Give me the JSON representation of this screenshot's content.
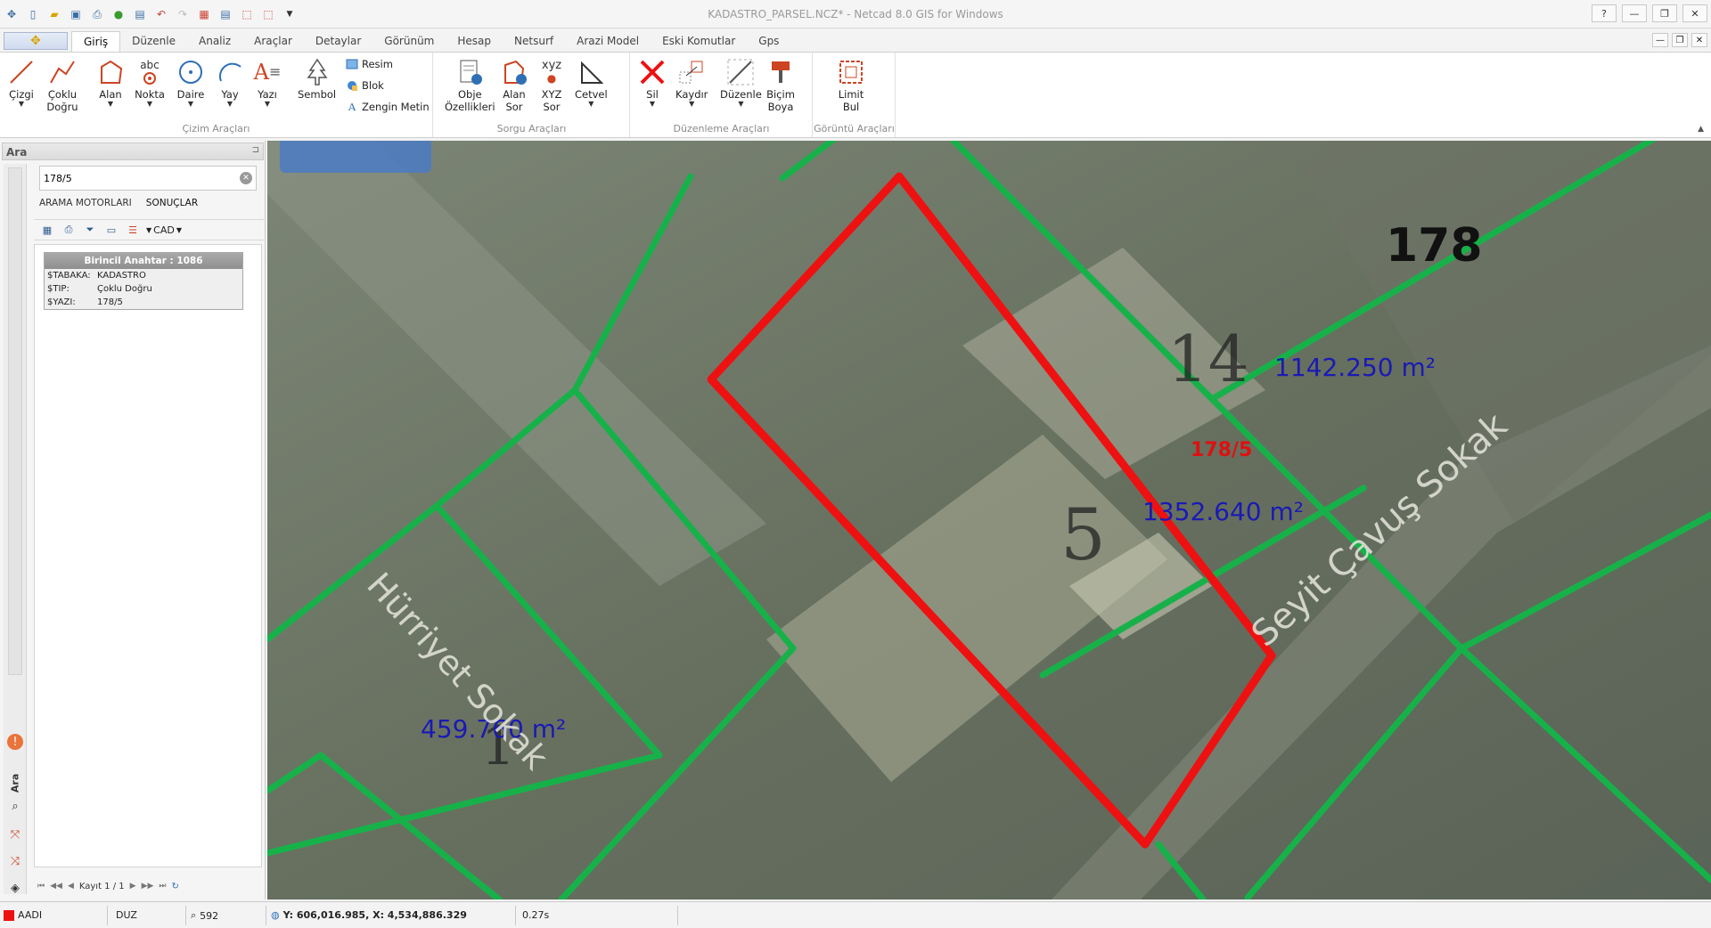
{
  "window": {
    "title": "KADASTRO_PARSEL.NCZ* - Netcad 8.0 GIS for Windows",
    "help": "?",
    "minimize": "—",
    "restore": "❐",
    "close": "✕"
  },
  "ribbon_tabs": [
    "Giriş",
    "Düzenle",
    "Analiz",
    "Araçlar",
    "Detaylar",
    "Görünüm",
    "Hesap",
    "Netsurf",
    "Arazi Model",
    "Eski Komutlar",
    "Gps"
  ],
  "ribbon": {
    "cizim": {
      "label": "Çizim Araçları",
      "cizgi": "Çizgi",
      "coklu": "Çoklu",
      "coklu2": "Doğru",
      "alan": "Alan",
      "nokta": "Nokta",
      "nokta_icon_text": "abc",
      "daire": "Daire",
      "yay": "Yay",
      "yazi": "Yazı",
      "sembol": "Sembol",
      "resim": "Resim",
      "blok": "Blok",
      "zengin": "Zengin Metin"
    },
    "sorgu": {
      "label": "Sorgu Araçları",
      "obje": "Obje",
      "obje2": "Özellikleri",
      "alan": "Alan",
      "alan2": "Sor",
      "xyz_icon_text": "xyz",
      "xyz": "XYZ",
      "xyz2": "Sor",
      "cetvel": "Cetvel"
    },
    "duzenleme": {
      "label": "Düzenleme Araçları",
      "sil": "Sil",
      "kaydir": "Kaydır",
      "duzenle": "Düzenle",
      "bicim": "Biçim",
      "bicim2": "Boya"
    },
    "goruntu": {
      "label": "Görüntü Araçları",
      "limit": "Limit",
      "limit2": "Bul"
    }
  },
  "left_panel": {
    "title": "Ara",
    "vertical_tab": "Ara",
    "search_value": "178/5",
    "subtabs": [
      "ARAMA MOTORLARI",
      "SONUÇLAR"
    ],
    "cad_label": "CAD",
    "card": {
      "header": "Birincil Anahtar : 1086",
      "rows": [
        {
          "k": "$TABAKA:",
          "v": "KADASTRO"
        },
        {
          "k": "$TIP:",
          "v": "Çoklu Doğru"
        },
        {
          "k": "$YAZI:",
          "v": "178/5"
        }
      ]
    },
    "pager_text": "Kayıt 1 / 1"
  },
  "map": {
    "block_label": "178",
    "selected_label": "178/5",
    "parcel_numbers": [
      "14",
      "5",
      "1"
    ],
    "areas": [
      "1142.250 m²",
      "1352.640 m²",
      "459.760 m²"
    ],
    "street_1": "Seyit Çavuş Sokak",
    "street_2": "Hürriyet Sokak",
    "colors": {
      "selected": "#ee1111",
      "parcel": "#17b14a",
      "area_text": "#1a1ab4",
      "label_text": "#dd1111"
    }
  },
  "status": {
    "layer": "AADI",
    "mode": "DUZ",
    "zoom": "592",
    "coords": "Y: 606,016.985, X: 4,534,886.329",
    "time": "0.27s"
  }
}
